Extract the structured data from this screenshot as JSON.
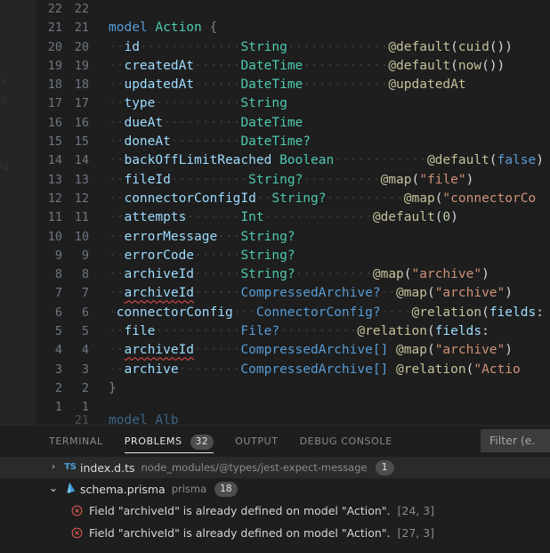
{
  "editor": {
    "ghost_fragments": [
      "s",
      "y",
      "ig"
    ],
    "clipped_line": {
      "old_no": "",
      "new_no": "21",
      "text": "model Alb"
    },
    "lines": [
      {
        "old": "22",
        "new": "22",
        "tokens": []
      },
      {
        "old": "21",
        "new": "21",
        "tokens": [
          {
            "t": "model ",
            "c": "t-kw"
          },
          {
            "t": "Action",
            "c": "t-model"
          },
          {
            "t": " {",
            "c": "t-punct"
          }
        ]
      },
      {
        "old": "20",
        "new": "20",
        "tokens": [
          {
            "t": "··",
            "c": "dot"
          },
          {
            "t": "id",
            "c": "t-field"
          },
          {
            "t": "·············",
            "c": "dot"
          },
          {
            "t": "String",
            "c": "t-type"
          },
          {
            "t": "·············",
            "c": "dot"
          },
          {
            "t": "@default",
            "c": "t-attr"
          },
          {
            "t": "(",
            "c": "t-paren"
          },
          {
            "t": "cuid",
            "c": "t-attr"
          },
          {
            "t": "())",
            "c": "t-paren"
          }
        ]
      },
      {
        "old": "19",
        "new": "19",
        "tokens": [
          {
            "t": "··",
            "c": "dot"
          },
          {
            "t": "createdAt",
            "c": "t-field"
          },
          {
            "t": "······",
            "c": "dot"
          },
          {
            "t": "DateTime",
            "c": "t-type"
          },
          {
            "t": "···········",
            "c": "dot"
          },
          {
            "t": "@default",
            "c": "t-attr"
          },
          {
            "t": "(",
            "c": "t-paren"
          },
          {
            "t": "now",
            "c": "t-attr"
          },
          {
            "t": "())",
            "c": "t-paren"
          }
        ]
      },
      {
        "old": "18",
        "new": "18",
        "tokens": [
          {
            "t": "··",
            "c": "dot"
          },
          {
            "t": "updatedAt",
            "c": "t-field"
          },
          {
            "t": "······",
            "c": "dot"
          },
          {
            "t": "DateTime",
            "c": "t-type"
          },
          {
            "t": "···········",
            "c": "dot"
          },
          {
            "t": "@updatedAt",
            "c": "t-attr"
          }
        ]
      },
      {
        "old": "17",
        "new": "17",
        "tokens": [
          {
            "t": "··",
            "c": "dot"
          },
          {
            "t": "type",
            "c": "t-field"
          },
          {
            "t": "···········",
            "c": "dot"
          },
          {
            "t": "String",
            "c": "t-type"
          }
        ]
      },
      {
        "old": "16",
        "new": "16",
        "tokens": [
          {
            "t": "··",
            "c": "dot"
          },
          {
            "t": "dueAt",
            "c": "t-field"
          },
          {
            "t": "··········",
            "c": "dot"
          },
          {
            "t": "DateTime",
            "c": "t-type"
          }
        ]
      },
      {
        "old": "15",
        "new": "15",
        "tokens": [
          {
            "t": "··",
            "c": "dot"
          },
          {
            "t": "doneAt",
            "c": "t-field"
          },
          {
            "t": "·········",
            "c": "dot"
          },
          {
            "t": "DateTime?",
            "c": "t-type"
          }
        ]
      },
      {
        "old": "14",
        "new": "14",
        "tokens": [
          {
            "t": "··",
            "c": "dot"
          },
          {
            "t": "backOffLimitReached",
            "c": "t-field"
          },
          {
            "t": " ",
            "c": "dot"
          },
          {
            "t": "Boolean",
            "c": "t-type"
          },
          {
            "t": "············",
            "c": "dot"
          },
          {
            "t": "@default",
            "c": "t-attr"
          },
          {
            "t": "(",
            "c": "t-paren"
          },
          {
            "t": "false",
            "c": "t-bool"
          },
          {
            "t": ")",
            "c": "t-paren"
          }
        ]
      },
      {
        "old": "13",
        "new": "13",
        "tokens": [
          {
            "t": "··",
            "c": "dot"
          },
          {
            "t": "fileId",
            "c": "t-field"
          },
          {
            "t": "··········",
            "c": "dot"
          },
          {
            "t": "String?",
            "c": "t-type"
          },
          {
            "t": "··········",
            "c": "dot"
          },
          {
            "t": "@map",
            "c": "t-attr"
          },
          {
            "t": "(",
            "c": "t-paren"
          },
          {
            "t": "\"file\"",
            "c": "t-str"
          },
          {
            "t": ")",
            "c": "t-paren"
          }
        ]
      },
      {
        "old": "12",
        "new": "12",
        "tokens": [
          {
            "t": "··",
            "c": "dot"
          },
          {
            "t": "connectorConfigId",
            "c": "t-field"
          },
          {
            "t": "··",
            "c": "dot"
          },
          {
            "t": "String?",
            "c": "t-type"
          },
          {
            "t": "··········",
            "c": "dot"
          },
          {
            "t": "@map",
            "c": "t-attr"
          },
          {
            "t": "(",
            "c": "t-paren"
          },
          {
            "t": "\"connectorCo",
            "c": "t-str"
          }
        ]
      },
      {
        "old": "11",
        "new": "11",
        "tokens": [
          {
            "t": "··",
            "c": "dot"
          },
          {
            "t": "attempts",
            "c": "t-field"
          },
          {
            "t": "·······",
            "c": "dot"
          },
          {
            "t": "Int",
            "c": "t-type"
          },
          {
            "t": "··············",
            "c": "dot"
          },
          {
            "t": "@default",
            "c": "t-attr"
          },
          {
            "t": "(",
            "c": "t-paren"
          },
          {
            "t": "0",
            "c": "t-num"
          },
          {
            "t": ")",
            "c": "t-paren"
          }
        ]
      },
      {
        "old": "10",
        "new": "10",
        "tokens": [
          {
            "t": "··",
            "c": "dot"
          },
          {
            "t": "errorMessage",
            "c": "t-field"
          },
          {
            "t": "···",
            "c": "dot"
          },
          {
            "t": "String?",
            "c": "t-type"
          }
        ]
      },
      {
        "old": "9",
        "new": "9",
        "tokens": [
          {
            "t": "··",
            "c": "dot"
          },
          {
            "t": "errorCode",
            "c": "t-field"
          },
          {
            "t": "······",
            "c": "dot"
          },
          {
            "t": "String?",
            "c": "t-type"
          }
        ]
      },
      {
        "old": "8",
        "new": "8",
        "tokens": [
          {
            "t": "··",
            "c": "dot"
          },
          {
            "t": "archiveId",
            "c": "t-field"
          },
          {
            "t": "······",
            "c": "dot"
          },
          {
            "t": "String?",
            "c": "t-type"
          },
          {
            "t": "··········",
            "c": "dot"
          },
          {
            "t": "@map",
            "c": "t-attr"
          },
          {
            "t": "(",
            "c": "t-paren"
          },
          {
            "t": "\"archive\"",
            "c": "t-str"
          },
          {
            "t": ")",
            "c": "t-paren"
          }
        ]
      },
      {
        "old": "7",
        "new": "7",
        "tokens": [
          {
            "t": "··",
            "c": "dot"
          },
          {
            "t": "archiveId",
            "c": "t-field squiggle"
          },
          {
            "t": "······",
            "c": "dot"
          },
          {
            "t": "CompressedArchive?",
            "c": "t-typeref"
          },
          {
            "t": "··",
            "c": "dot"
          },
          {
            "t": "@map",
            "c": "t-attr"
          },
          {
            "t": "(",
            "c": "t-paren"
          },
          {
            "t": "\"archive\"",
            "c": "t-str"
          },
          {
            "t": ")",
            "c": "t-paren"
          }
        ]
      },
      {
        "old": "6",
        "new": "6",
        "tokens": [
          {
            "t": "·",
            "c": "dot"
          },
          {
            "t": "connectorConfig",
            "c": "t-field"
          },
          {
            "t": "···",
            "c": "dot"
          },
          {
            "t": "ConnectorConfig?",
            "c": "t-typeref"
          },
          {
            "t": "····",
            "c": "dot"
          },
          {
            "t": "@relation",
            "c": "t-attr"
          },
          {
            "t": "(",
            "c": "t-paren"
          },
          {
            "t": "fields",
            "c": "t-arg"
          },
          {
            "t": ": [",
            "c": "t-paren"
          }
        ]
      },
      {
        "old": "5",
        "new": "5",
        "tokens": [
          {
            "t": "··",
            "c": "dot"
          },
          {
            "t": "file",
            "c": "t-field"
          },
          {
            "t": "···········",
            "c": "dot"
          },
          {
            "t": "File?",
            "c": "t-typeref"
          },
          {
            "t": "··········",
            "c": "dot"
          },
          {
            "t": "@relation",
            "c": "t-attr"
          },
          {
            "t": "(",
            "c": "t-paren"
          },
          {
            "t": "fields",
            "c": "t-arg"
          },
          {
            "t": ":",
            "c": "t-paren"
          }
        ]
      },
      {
        "old": "4",
        "new": "4",
        "tokens": [
          {
            "t": "··",
            "c": "dot"
          },
          {
            "t": "archiveId",
            "c": "t-field squiggle"
          },
          {
            "t": "······",
            "c": "dot"
          },
          {
            "t": "CompressedArchive[]",
            "c": "t-typeref"
          },
          {
            "t": " ",
            "c": "dot"
          },
          {
            "t": "@map",
            "c": "t-attr"
          },
          {
            "t": "(",
            "c": "t-paren"
          },
          {
            "t": "\"archive\"",
            "c": "t-str"
          },
          {
            "t": ")",
            "c": "t-paren"
          }
        ]
      },
      {
        "old": "3",
        "new": "3",
        "tokens": [
          {
            "t": "··",
            "c": "dot"
          },
          {
            "t": "archive",
            "c": "t-field"
          },
          {
            "t": "········",
            "c": "dot"
          },
          {
            "t": "CompressedArchive[]",
            "c": "t-typeref"
          },
          {
            "t": " ",
            "c": "dot"
          },
          {
            "t": "@relation",
            "c": "t-attr"
          },
          {
            "t": "(",
            "c": "t-paren"
          },
          {
            "t": "\"Actio",
            "c": "t-str"
          }
        ]
      },
      {
        "old": "2",
        "new": "2",
        "tokens": [
          {
            "t": "}",
            "c": "t-punct"
          }
        ]
      },
      {
        "old": "1",
        "new": "1",
        "tokens": []
      }
    ]
  },
  "panel": {
    "tabs": [
      {
        "label": "TERMINAL",
        "active": false,
        "badge": null
      },
      {
        "label": "PROBLEMS",
        "active": true,
        "badge": "32"
      },
      {
        "label": "OUTPUT",
        "active": false,
        "badge": null
      },
      {
        "label": "DEBUG CONSOLE",
        "active": false,
        "badge": null
      }
    ],
    "filter": {
      "placeholder": "Filter (e."
    },
    "problems": [
      {
        "kind": "file",
        "expanded": false,
        "icon": "typescript-file-icon",
        "icon_glyph": "TS",
        "name": "index.d.ts",
        "path": "node_modules/@types/jest-expect-message",
        "count": "1",
        "highlighted": true
      },
      {
        "kind": "file",
        "expanded": true,
        "icon": "prisma-file-icon",
        "icon_glyph": "",
        "name": "schema.prisma",
        "path": "prisma",
        "count": "18",
        "highlighted": false
      },
      {
        "kind": "error",
        "icon": "error-circle-icon",
        "message": "Field \"archiveId\" is already defined on model \"Action\".",
        "position": "[24, 3]"
      },
      {
        "kind": "error",
        "icon": "error-circle-icon",
        "message": "Field \"archiveId\" is already defined on model \"Action\".",
        "position": "[27, 3]"
      }
    ]
  },
  "colors": {
    "editor_bg": "#1e1e1e",
    "panel_bg": "#1e1e1e",
    "error_red": "#f14c4c",
    "prisma_blue": "#4a9fd8",
    "accent_text": "#e7e7e7"
  }
}
